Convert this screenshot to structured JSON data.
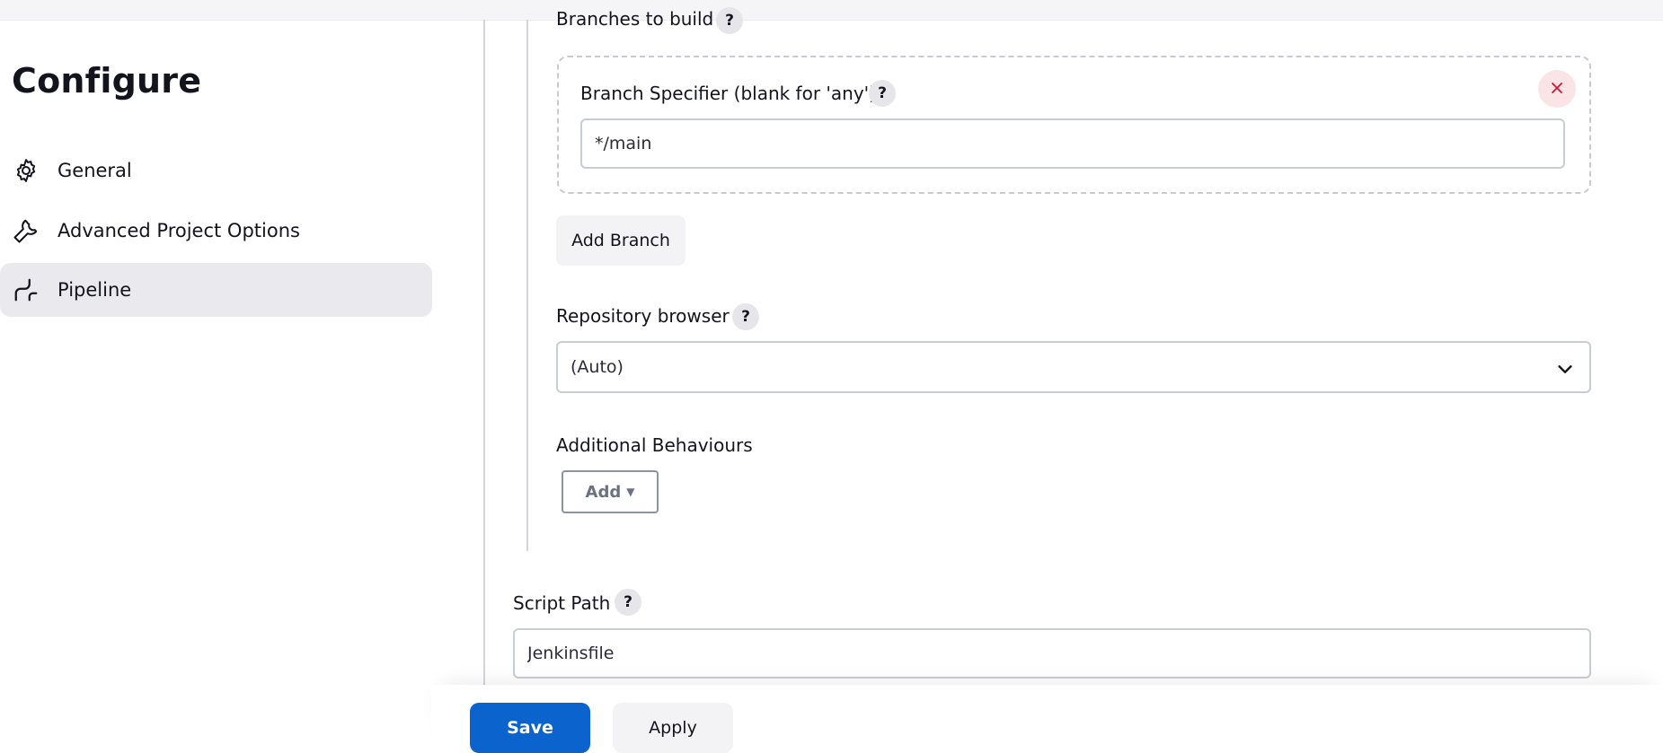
{
  "sidebar": {
    "title": "Configure",
    "items": [
      {
        "label": "General",
        "icon": "gear-icon"
      },
      {
        "label": "Advanced Project Options",
        "icon": "wrench-icon"
      },
      {
        "label": "Pipeline",
        "icon": "pipeline-icon",
        "active": true
      }
    ]
  },
  "scm": {
    "branches_label": "Branches to build",
    "branch_specifier": {
      "label": "Branch Specifier (blank for 'any')",
      "value": "*/main",
      "delete_icon": "close-icon"
    },
    "add_branch_label": "Add Branch",
    "repo_browser": {
      "label": "Repository browser",
      "selected": "(Auto)"
    },
    "additional_behaviours": {
      "label": "Additional Behaviours",
      "add_label": "Add"
    }
  },
  "script_path": {
    "label": "Script Path",
    "value": "Jenkinsfile"
  },
  "help_symbol": "?",
  "footer": {
    "save_label": "Save",
    "apply_label": "Apply"
  },
  "colors": {
    "primary": "#0b63ce",
    "danger": "#d0162f",
    "active_bg": "#eaeaee"
  }
}
